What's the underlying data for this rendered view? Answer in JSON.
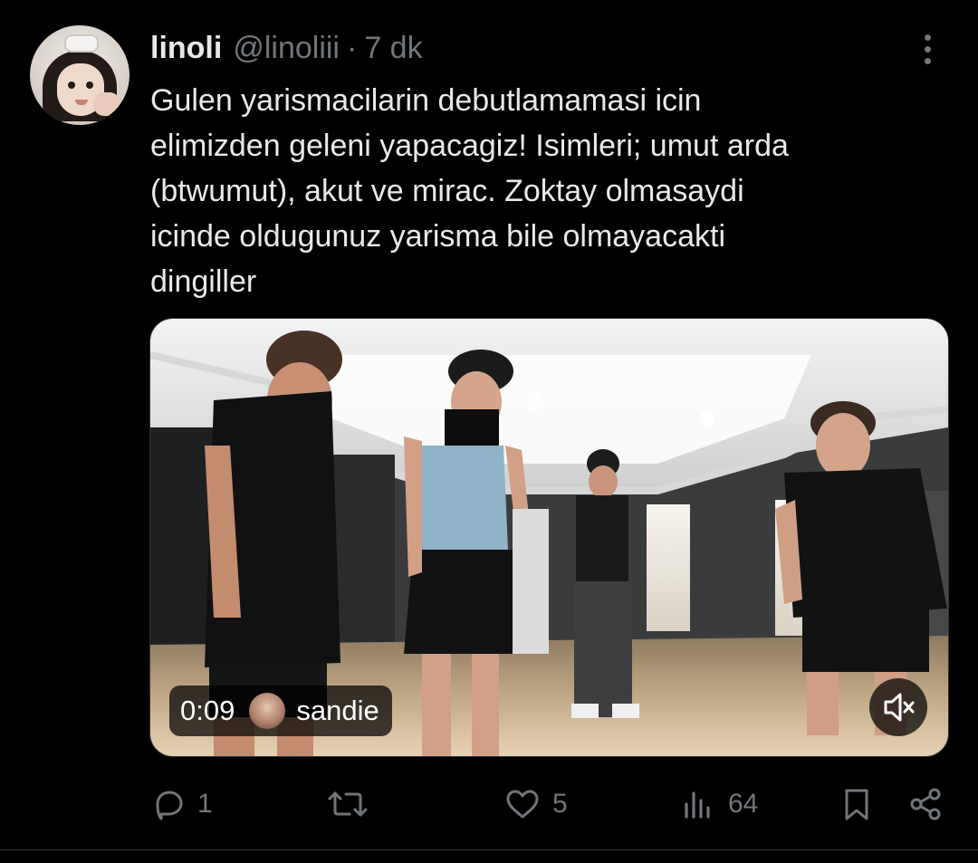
{
  "author": {
    "name": "linoli",
    "handle": "@linoliii",
    "separator": "·",
    "time": "7 dk"
  },
  "tweet": {
    "text": "Gulen yarismacilarin debutlamamasi icin\nelimizden geleni yapacagiz! Isimleri; umut arda\n(btwumut), akut ve mirac. Zoktay olmasaydi\nicinde oldugunuz yarisma bile olmayacakti\ndingiller"
  },
  "video": {
    "duration": "0:09",
    "attribution": "sandie",
    "muted": true
  },
  "actions": {
    "reply_count": "1",
    "retweet_count": "",
    "like_count": "5",
    "views_count": "64"
  },
  "colors": {
    "background": "#000000",
    "text": "#e7e9ea",
    "secondary": "#71767b",
    "border": "#2f3336"
  }
}
